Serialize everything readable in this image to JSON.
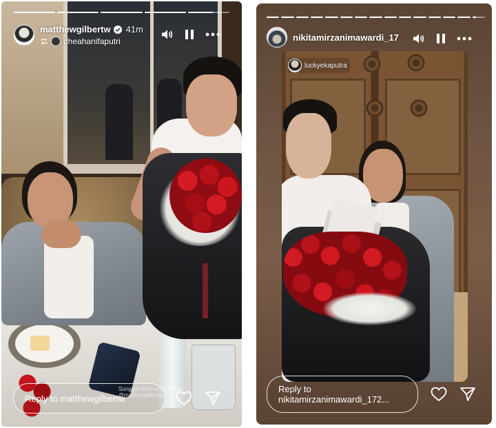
{
  "left_story": {
    "progress": [
      1,
      1,
      1,
      1,
      0.6
    ],
    "username": "matthewgilbertw",
    "verified": true,
    "time_ago": "41m",
    "reposted_from": "dheahanifaputri",
    "reply_placeholder": "Reply to matthewgilbertw",
    "overlay_caption": "Sungguh Romantis Kalian",
    "overlay_handle": "@matthewgilbertw"
  },
  "right_story": {
    "progress": [
      1,
      1,
      1,
      1,
      1,
      1,
      1,
      1,
      1,
      1,
      1,
      1,
      1,
      1,
      0.3
    ],
    "username": "nikitamirzanimawardi_17",
    "tagged_user": "luckyekaputra",
    "reply_label": "Reply to",
    "reply_target": "nikitamirzanimawardi_172..."
  },
  "icons": {
    "sound": "speaker-icon",
    "pause": "pause-icon",
    "more": "more-dots-icon",
    "like": "heart-icon",
    "share": "send-icon",
    "verified": "verified-badge-icon",
    "repost": "repost-icon"
  },
  "colors": {
    "left_bg": "#3a2a1e",
    "right_bg": "#6d5341",
    "text": "#ffffff"
  }
}
